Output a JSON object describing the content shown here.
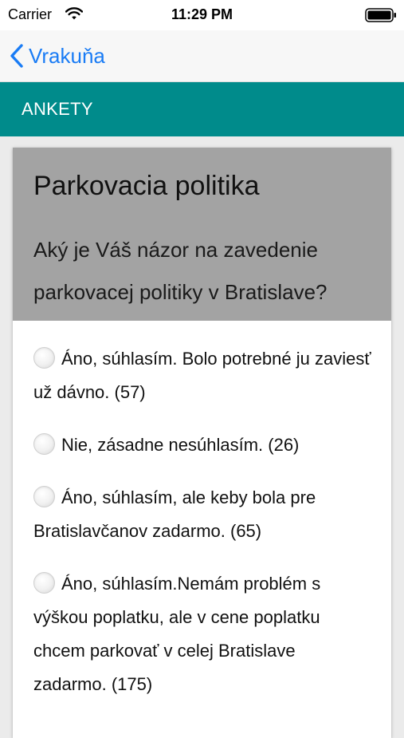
{
  "status_bar": {
    "carrier": "Carrier",
    "time": "11:29 PM"
  },
  "nav": {
    "back_label": "Vrakuňa",
    "back_color": "#1a7cf5"
  },
  "section": {
    "title": "ANKETY",
    "color": "#008b8b"
  },
  "poll": {
    "title": "Parkovacia politika",
    "question": "Aký je Váš názor na zavedenie parkovacej politiky v Bratislave?",
    "options": [
      {
        "label": "Áno, súhlasím. Bolo potrebné ju zaviesť už dávno. (57)"
      },
      {
        "label": "Nie, zásadne nesúhlasím. (26)"
      },
      {
        "label": "Áno, súhlasím, ale keby bola pre Bratislavčanov zadarmo. (65)"
      },
      {
        "label": "Áno, súhlasím.Nemám problém s výškou poplatku, ale v cene poplatku chcem parkovať v celej Bratislave zadarmo. (175)"
      }
    ]
  }
}
